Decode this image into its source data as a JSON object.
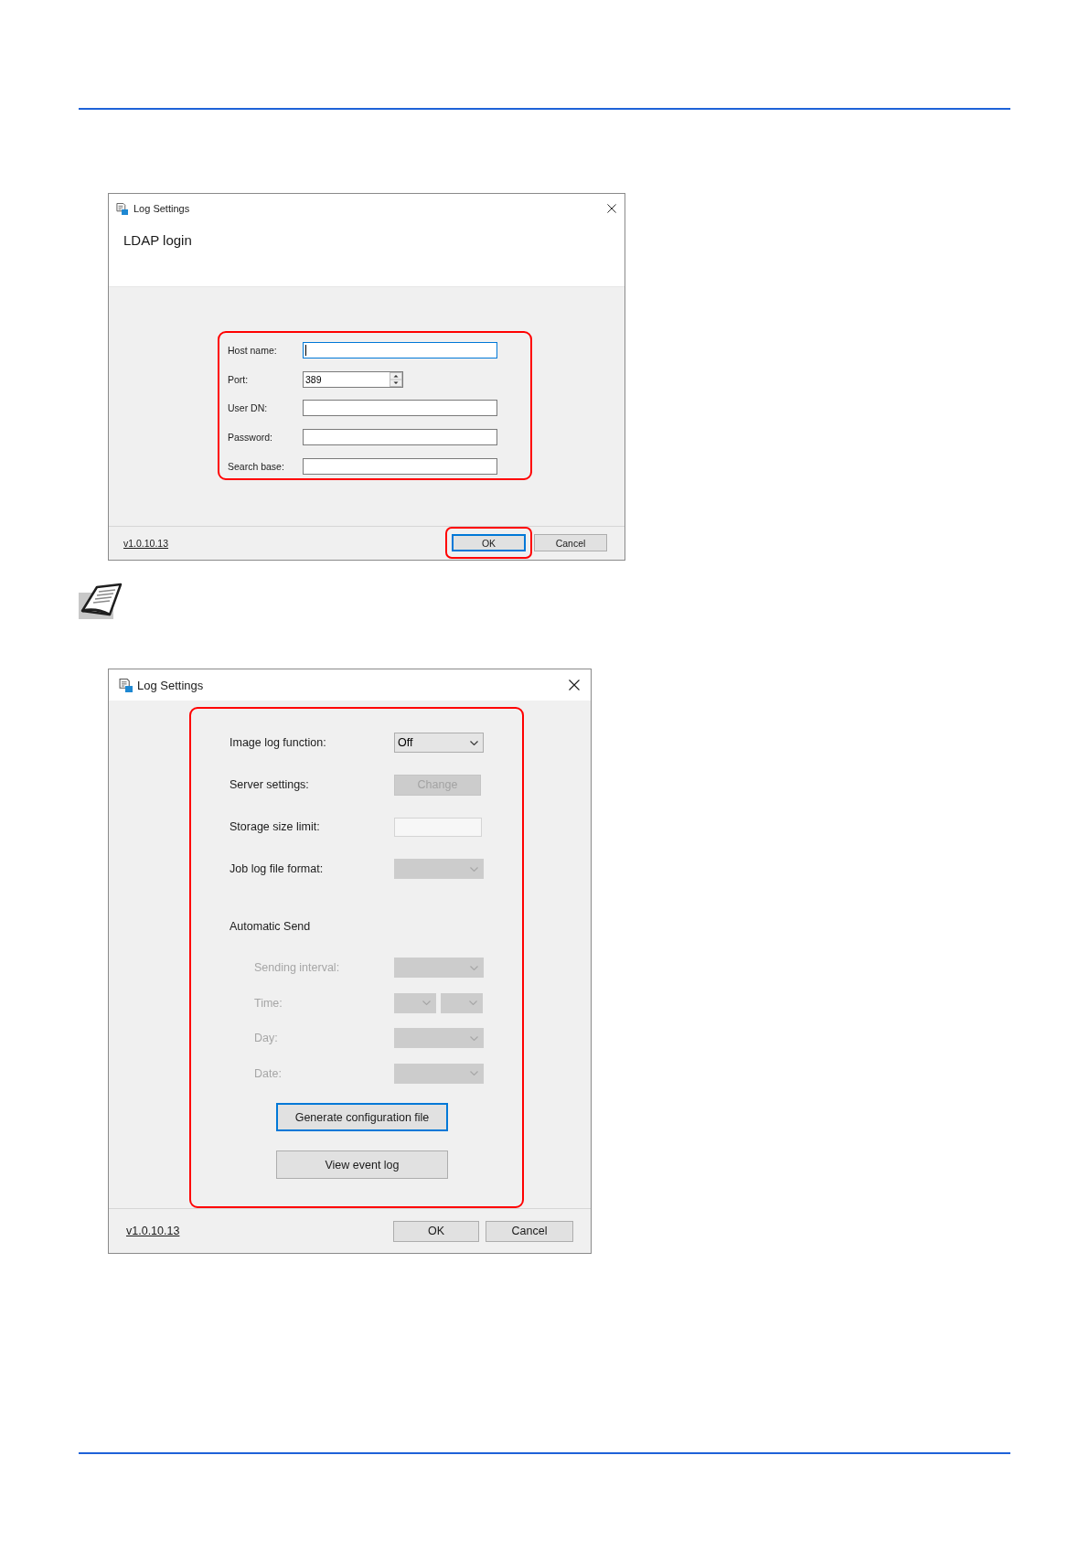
{
  "dialogs": [
    {
      "kind": "login",
      "title": "Log Settings",
      "heading": "LDAP login",
      "form": {
        "callout": true,
        "fields": [
          {
            "label": "Host name:",
            "kind": "text",
            "focused": true
          },
          {
            "label": "Port:",
            "kind": "spinner",
            "value": "389",
            "focused": false
          },
          {
            "label": "User DN:",
            "kind": "text",
            "focused": false
          },
          {
            "label": "Password:",
            "kind": "text",
            "focused": false
          },
          {
            "label": "Search base:",
            "kind": "text",
            "focused": false
          }
        ]
      },
      "version": "v1.0.10.13",
      "buttons": [
        {
          "label": "OK",
          "focused": true,
          "callout": true
        },
        {
          "label": "Cancel",
          "focused": false,
          "callout": false
        }
      ]
    },
    {
      "kind": "settings",
      "title": "Log Settings",
      "form": {
        "callout": true,
        "rows": [
          {
            "label": "Image log function:",
            "kind": "dropdown",
            "value": "Off",
            "disabled": false
          },
          {
            "label": "Server settings:",
            "kind": "button",
            "button_label": "Change",
            "disabled": true
          },
          {
            "label": "Storage size limit:",
            "kind": "text",
            "disabled": true
          },
          {
            "label": "Job log file format:",
            "kind": "dropdown",
            "disabled": true
          }
        ],
        "section": {
          "label": "Automatic Send",
          "children": [
            {
              "label": "Sending interval:",
              "kind": "dropdown",
              "disabled": true
            },
            {
              "label": "Time:",
              "kind": "dropdown_pair",
              "disabled": true
            },
            {
              "label": "Day:",
              "kind": "dropdown",
              "disabled": true
            },
            {
              "label": "Date:",
              "kind": "dropdown",
              "disabled": true
            }
          ]
        },
        "actions": [
          {
            "label": "Generate configuration file",
            "focused": true
          },
          {
            "label": "View event log",
            "focused": false
          }
        ]
      },
      "version": "v1.0.10.13",
      "buttons": [
        {
          "label": "OK",
          "focused": false,
          "callout": false
        },
        {
          "label": "Cancel",
          "focused": false,
          "callout": false
        }
      ]
    }
  ]
}
